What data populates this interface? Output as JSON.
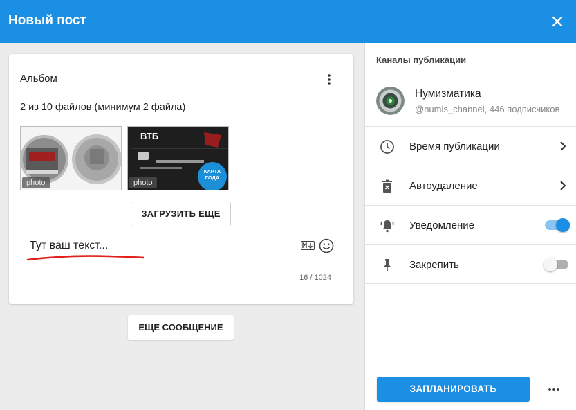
{
  "header": {
    "title": "Новый пост",
    "close_icon": "close-icon"
  },
  "post": {
    "album_title": "Альбом",
    "files_info": "2 из 10 файлов (минимум 2 файла)",
    "photos": [
      {
        "badge": "photo",
        "subject": "commemorative-coins"
      },
      {
        "badge": "photo",
        "subject": "vtb-bank-card",
        "brand": "ВТБ",
        "sticker": "КАРТА ГОДА"
      }
    ],
    "upload_more_label": "ЗАГРУЗИТЬ ЕЩЕ",
    "message_text": "Тут ваш текст...",
    "char_counter": "16 / 1024",
    "underline_color": "#e0221b"
  },
  "more_message_label": "ЕЩЕ СООБЩЕНИЕ",
  "sidebar": {
    "channels_label": "Каналы публикации",
    "channel": {
      "name": "Нумизматика",
      "subtitle": "@numis_channel, 446 подписчиков"
    },
    "options": [
      {
        "label": "Время публикации",
        "icon": "clock-icon",
        "control": "chevron"
      },
      {
        "label": "Автоудаление",
        "icon": "delete-timer-icon",
        "control": "chevron"
      },
      {
        "label": "Уведомление",
        "icon": "bell-ring-icon",
        "control": "toggle",
        "enabled": true
      },
      {
        "label": "Закрепить",
        "icon": "pin-icon",
        "control": "toggle",
        "enabled": false
      }
    ],
    "schedule_label": "ЗАПЛАНИРОВАТЬ"
  },
  "colors": {
    "accent": "#1a8fe3",
    "background": "#ececec"
  }
}
